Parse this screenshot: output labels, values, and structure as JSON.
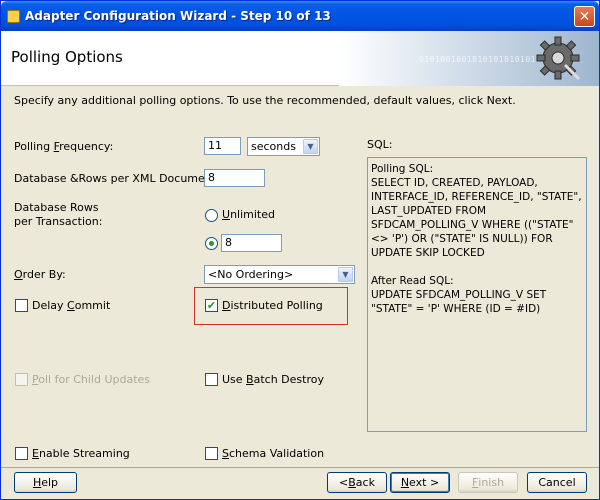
{
  "window": {
    "title": "Adapter Configuration Wizard - Step 10 of 13"
  },
  "header": {
    "title": "Polling Options",
    "binary_pattern": "0101001001010101010101010"
  },
  "intro_text": "Specify any additional polling options.  To use the recommended, default values, click Next.",
  "polling_frequency": {
    "label_pre": "Polling ",
    "label_accel": "F",
    "label_post": "requency:",
    "value": "11",
    "unit": "seconds"
  },
  "rows_per_doc": {
    "label": "Database &Rows per XML Document:",
    "value": "8"
  },
  "rows_per_txn": {
    "label_line1": "Database Rows",
    "label_line2": "per Transaction:",
    "unlimited_accel": "U",
    "unlimited_rest": "nlimited",
    "value": "8",
    "selected": "value"
  },
  "order_by": {
    "label_accel": "O",
    "label_rest": "rder By:",
    "value": "<No Ordering>"
  },
  "options": {
    "delay_commit": {
      "pre": "Delay ",
      "accel": "C",
      "post": "ommit",
      "checked": false
    },
    "distributed_polling": {
      "pre": "",
      "accel": "D",
      "post": "istributed Polling",
      "checked": true
    },
    "poll_child_updates": {
      "pre": "",
      "accel": "P",
      "post": "oll for Child Updates",
      "checked": false,
      "enabled": false
    },
    "use_batch_destroy": {
      "pre": "Use ",
      "accel": "B",
      "post": "atch Destroy",
      "checked": false
    },
    "enable_streaming": {
      "pre": "",
      "accel": "E",
      "post": "nable Streaming",
      "checked": false
    },
    "schema_validation": {
      "pre": "",
      "accel": "S",
      "post": "chema Validation",
      "checked": false
    }
  },
  "sql": {
    "label": "SQL:",
    "text": "Polling SQL:\nSELECT ID, CREATED, PAYLOAD, INTERFACE_ID, REFERENCE_ID, \"STATE\", LAST_UPDATED FROM SFDCAM_POLLING_V WHERE ((\"STATE\" <> 'P') OR (\"STATE\" IS NULL)) FOR UPDATE SKIP LOCKED\n\nAfter Read SQL:\nUPDATE SFDCAM_POLLING_V SET \"STATE\" = 'P' WHERE (ID = #ID)"
  },
  "buttons": {
    "help_accel": "H",
    "help_rest": "elp",
    "back_pre": "< ",
    "back_accel": "B",
    "back_rest": "ack",
    "next_accel": "N",
    "next_rest": "ext >",
    "finish_accel": "F",
    "finish_rest": "inish",
    "cancel": "Cancel"
  },
  "colors": {
    "titlebar": "#0054e3",
    "highlight": "#d43030",
    "check": "#21a121"
  }
}
